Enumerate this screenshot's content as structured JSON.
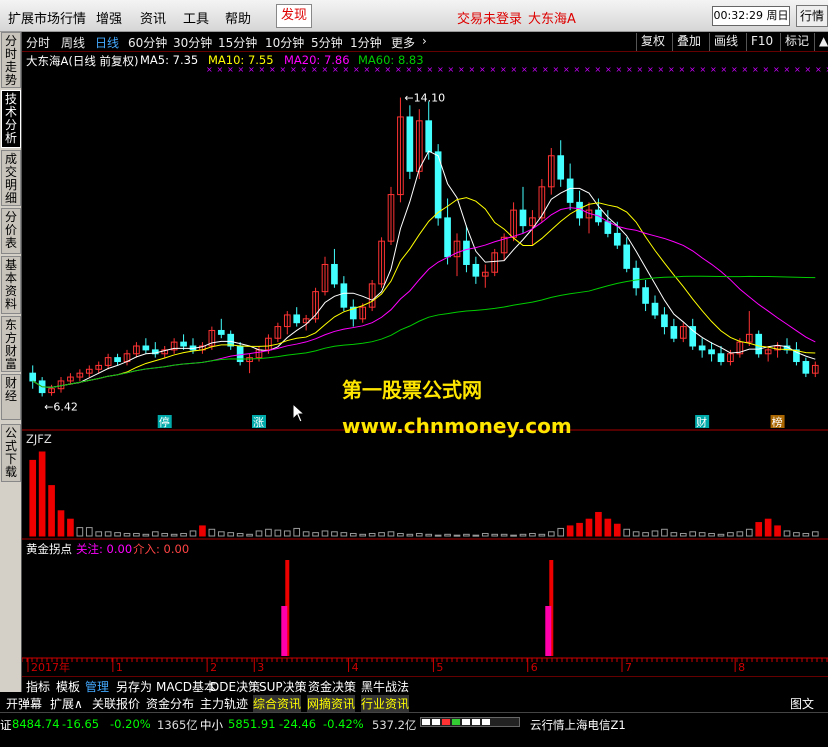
{
  "menubar": {
    "items": [
      "扩展市场行情",
      "增强",
      "资讯",
      "工具",
      "帮助"
    ],
    "discover": "发现",
    "login_status": "交易未登录",
    "stock_name": "大东海A",
    "clock": "00:32:29 周日",
    "quote_button": "行情"
  },
  "sidebar": {
    "tabs": [
      "分时走势",
      "技术分析",
      "成交明细",
      "分价表",
      "基本资料",
      "东方财富",
      "财经",
      "公式下载"
    ],
    "active_index": 1
  },
  "periods": {
    "items": [
      "分时",
      "周线",
      "日线",
      "60分钟",
      "30分钟",
      "15分钟",
      "10分钟",
      "5分钟",
      "1分钟",
      "更多"
    ],
    "active": "日线",
    "more_arrow": "›"
  },
  "tools": [
    "复权",
    "叠加",
    "画线",
    "F10",
    "标记"
  ],
  "ma_legend": {
    "title": "大东海A(日线 前复权)",
    "ma5": "MA5: 7.35",
    "ma10": "MA10: 7.55",
    "ma20": "MA20: 7.86",
    "ma60": "MA60: 8.83",
    "colors": {
      "ma5": "#ffffff",
      "ma10": "#ffff00",
      "ma20": "#ff00ff",
      "ma60": "#00cc00"
    }
  },
  "price_chart": {
    "high_label": "14.10",
    "low_label": "6.42",
    "markers": {
      "stop": "停",
      "rise": "涨",
      "finance": "财",
      "rank": "榜"
    }
  },
  "zjfz_panel": {
    "title": "ZJFZ"
  },
  "golden_panel": {
    "title": "黄金拐点",
    "focus": "关注: 0.00",
    "enter": "介入: 0.00"
  },
  "time_axis": {
    "labels": [
      "2017年",
      "1",
      "2",
      "3",
      "4",
      "5",
      "6",
      "7",
      "8"
    ]
  },
  "watermark": {
    "line1": "第一股票公式网",
    "line2": "www.chnmoney.com"
  },
  "index_tabs": [
    "指标",
    "模板",
    "管理",
    "另存为",
    "MACD基本",
    "DDE决策",
    "SUP决策",
    "资金决策",
    "黑牛战法"
  ],
  "index_tabs_selected": "管理",
  "function_bar": [
    "开弹幕",
    "扩展∧",
    "关联报价",
    "资金分布",
    "主力轨迹",
    "综合资讯",
    "网摘资讯",
    "行业资讯"
  ],
  "function_bar_right": "图文F10",
  "status": {
    "idx1_label": "证",
    "idx1_value": "8484.74",
    "idx1_change": "-16.65",
    "idx1_pct": "-0.20%",
    "idx1_amount": "1365亿",
    "idx2_label": "中小",
    "idx2_value": "5851.91",
    "idx2_change": "-24.46",
    "idx2_pct": "-0.42%",
    "idx2_amount": "537.2亿",
    "server": "云行情上海电信Z1"
  },
  "chart_data": {
    "type": "candlestick",
    "ylim": [
      6.0,
      14.5
    ],
    "candles": [
      [
        7.0,
        7.2,
        6.6,
        6.8
      ],
      [
        6.8,
        6.9,
        6.4,
        6.5
      ],
      [
        6.5,
        6.7,
        6.42,
        6.6
      ],
      [
        6.6,
        6.9,
        6.5,
        6.8
      ],
      [
        6.8,
        7.0,
        6.7,
        6.9
      ],
      [
        6.9,
        7.1,
        6.8,
        7.0
      ],
      [
        7.0,
        7.2,
        6.9,
        7.1
      ],
      [
        7.1,
        7.3,
        7.0,
        7.2
      ],
      [
        7.2,
        7.5,
        7.1,
        7.4
      ],
      [
        7.4,
        7.5,
        7.2,
        7.3
      ],
      [
        7.3,
        7.6,
        7.2,
        7.5
      ],
      [
        7.5,
        7.8,
        7.4,
        7.7
      ],
      [
        7.7,
        7.9,
        7.5,
        7.6
      ],
      [
        7.6,
        7.8,
        7.4,
        7.5
      ],
      [
        7.5,
        7.7,
        7.4,
        7.6
      ],
      [
        7.6,
        7.9,
        7.5,
        7.8
      ],
      [
        7.8,
        8.0,
        7.6,
        7.7
      ],
      [
        7.7,
        7.9,
        7.5,
        7.6
      ],
      [
        7.6,
        7.8,
        7.5,
        7.7
      ],
      [
        7.7,
        8.2,
        7.6,
        8.1
      ],
      [
        8.1,
        8.4,
        7.9,
        8.0
      ],
      [
        8.0,
        8.1,
        7.6,
        7.7
      ],
      [
        7.7,
        7.8,
        7.2,
        7.3
      ],
      [
        7.3,
        7.5,
        7.0,
        7.4
      ],
      [
        7.4,
        7.7,
        7.3,
        7.6
      ],
      [
        7.6,
        8.0,
        7.5,
        7.9
      ],
      [
        7.9,
        8.3,
        7.8,
        8.2
      ],
      [
        8.2,
        8.6,
        8.0,
        8.5
      ],
      [
        8.5,
        8.7,
        8.2,
        8.3
      ],
      [
        8.3,
        8.5,
        8.1,
        8.4
      ],
      [
        8.4,
        9.2,
        8.3,
        9.1
      ],
      [
        9.1,
        10.0,
        9.0,
        9.8
      ],
      [
        9.8,
        10.2,
        9.2,
        9.3
      ],
      [
        9.3,
        9.5,
        8.6,
        8.7
      ],
      [
        8.7,
        8.9,
        8.2,
        8.4
      ],
      [
        8.4,
        8.8,
        8.3,
        8.7
      ],
      [
        8.7,
        9.4,
        8.6,
        9.3
      ],
      [
        9.3,
        10.5,
        9.2,
        10.4
      ],
      [
        10.4,
        11.8,
        10.3,
        11.6
      ],
      [
        11.6,
        14.1,
        11.4,
        13.6
      ],
      [
        13.6,
        13.9,
        12.0,
        12.2
      ],
      [
        12.2,
        13.8,
        12.0,
        13.5
      ],
      [
        13.5,
        14.0,
        12.5,
        12.7
      ],
      [
        12.7,
        12.9,
        10.8,
        11.0
      ],
      [
        11.0,
        11.5,
        9.8,
        10.0
      ],
      [
        10.0,
        10.6,
        9.5,
        10.4
      ],
      [
        10.4,
        10.8,
        9.6,
        9.8
      ],
      [
        9.8,
        10.0,
        9.3,
        9.5
      ],
      [
        9.5,
        9.8,
        9.2,
        9.6
      ],
      [
        9.6,
        10.2,
        9.5,
        10.1
      ],
      [
        10.1,
        10.6,
        9.9,
        10.5
      ],
      [
        10.5,
        11.4,
        10.4,
        11.2
      ],
      [
        11.2,
        11.8,
        10.6,
        10.8
      ],
      [
        10.8,
        11.2,
        10.3,
        11.0
      ],
      [
        11.0,
        12.0,
        10.9,
        11.8
      ],
      [
        11.8,
        12.8,
        11.6,
        12.6
      ],
      [
        12.6,
        13.0,
        11.8,
        12.0
      ],
      [
        12.0,
        12.4,
        11.2,
        11.4
      ],
      [
        11.4,
        11.7,
        10.8,
        11.0
      ],
      [
        11.0,
        11.4,
        10.6,
        11.2
      ],
      [
        11.2,
        11.5,
        10.8,
        10.9
      ],
      [
        10.9,
        11.2,
        10.5,
        10.6
      ],
      [
        10.6,
        10.9,
        10.2,
        10.3
      ],
      [
        10.3,
        10.5,
        9.6,
        9.7
      ],
      [
        9.7,
        9.9,
        9.0,
        9.2
      ],
      [
        9.2,
        9.4,
        8.6,
        8.8
      ],
      [
        8.8,
        9.0,
        8.4,
        8.5
      ],
      [
        8.5,
        8.7,
        8.0,
        8.2
      ],
      [
        8.2,
        8.4,
        7.8,
        7.9
      ],
      [
        7.9,
        8.3,
        7.8,
        8.2
      ],
      [
        8.2,
        8.4,
        7.6,
        7.7
      ],
      [
        7.7,
        7.9,
        7.4,
        7.6
      ],
      [
        7.6,
        7.8,
        7.3,
        7.5
      ],
      [
        7.5,
        7.7,
        7.2,
        7.3
      ],
      [
        7.3,
        7.6,
        7.2,
        7.5
      ],
      [
        7.5,
        7.9,
        7.4,
        7.8
      ],
      [
        7.8,
        8.6,
        7.7,
        8.0
      ],
      [
        8.0,
        8.1,
        7.4,
        7.5
      ],
      [
        7.5,
        7.7,
        7.3,
        7.6
      ],
      [
        7.6,
        7.8,
        7.4,
        7.7
      ],
      [
        7.7,
        7.9,
        7.5,
        7.6
      ],
      [
        7.6,
        7.8,
        7.2,
        7.3
      ],
      [
        7.3,
        7.4,
        6.9,
        7.0
      ],
      [
        7.0,
        7.3,
        6.9,
        7.2
      ]
    ],
    "zjfz": [
      9,
      10,
      6,
      3,
      2,
      1,
      1,
      0.5,
      0.5,
      0.4,
      0.3,
      0.3,
      0.2,
      0.5,
      0.3,
      0.2,
      0.3,
      0.6,
      1.2,
      0.8,
      0.5,
      0.4,
      0.3,
      0.2,
      0.6,
      0.8,
      0.7,
      0.6,
      0.9,
      0.5,
      0.4,
      0.6,
      0.5,
      0.4,
      0.3,
      0.2,
      0.3,
      0.4,
      0.5,
      0.3,
      0.2,
      0.3,
      0.2,
      0.1,
      0.2,
      0.1,
      0.2,
      0.1,
      0.3,
      0.2,
      0.2,
      0.1,
      0.2,
      0.3,
      0.2,
      0.5,
      0.9,
      1.2,
      1.5,
      2.0,
      2.8,
      2.0,
      1.4,
      0.8,
      0.5,
      0.4,
      0.6,
      0.8,
      0.4,
      0.3,
      0.5,
      0.4,
      0.3,
      0.2,
      0.4,
      0.5,
      0.8,
      1.6,
      2.0,
      1.2,
      0.6,
      0.4,
      0.3,
      0.5
    ],
    "golden_spikes": [
      {
        "index": 27,
        "value": 1.0
      },
      {
        "index": 55,
        "value": 1.0
      }
    ]
  }
}
